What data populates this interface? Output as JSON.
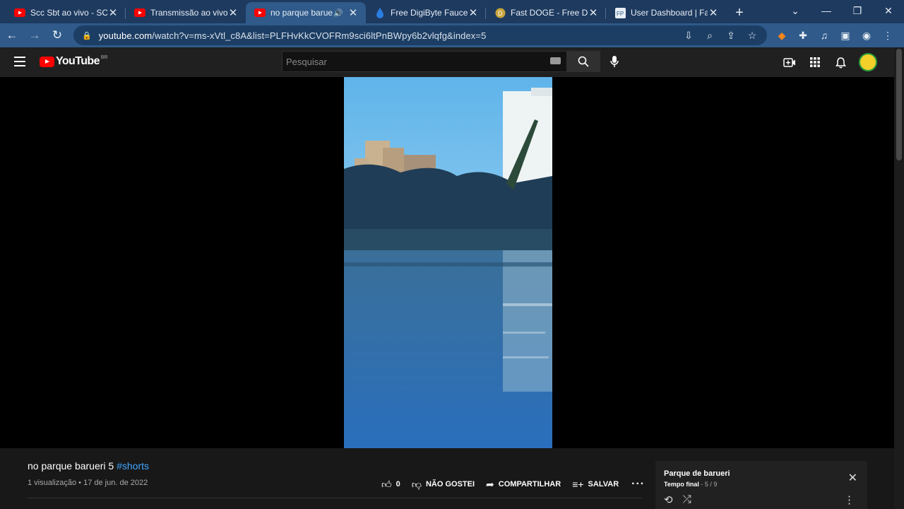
{
  "browser": {
    "tabs": [
      {
        "title": "Scc Sbt ao vivo - SCC",
        "favicon": "youtube-icon",
        "active": false
      },
      {
        "title": "Transmissão ao vivo -",
        "favicon": "youtube-icon",
        "active": false
      },
      {
        "title": "no parque barueri",
        "favicon": "youtube-icon",
        "active": true,
        "audio": true
      },
      {
        "title": "Free DigiByte Faucet",
        "favicon": "digibyte-drop-icon",
        "active": false
      },
      {
        "title": "Fast DOGE - Free Dog",
        "favicon": "dogecoin-icon",
        "active": false
      },
      {
        "title": "User Dashboard | Fau",
        "favicon": "fp-icon",
        "active": false
      }
    ],
    "url_host": "youtube.com",
    "url_rest": "/watch?v=ms-xVtl_c8A&list=PLFHvKkCVOFRm9sci6ltPnBWpy6b2vlqfg&index=5",
    "colors": {
      "frame": "#1e3a5f",
      "toolbar": "#2f5a8a"
    }
  },
  "youtube": {
    "logo_text": "YouTube",
    "region": "BR",
    "search_placeholder": "Pesquisar",
    "video": {
      "title": "no parque barueri 5",
      "hashtag": "#shorts",
      "views": "1 visualização",
      "separator": "•",
      "date": "17 de jun. de 2022",
      "likes": "0",
      "dislike_label": "NÃO GOSTEI",
      "share_label": "COMPARTILHAR",
      "save_label": "SALVAR"
    },
    "playlist": {
      "title": "Parque de barueri",
      "subtitle_bold": "Tempo final",
      "subtitle_rest": "- 5 / 9"
    }
  }
}
